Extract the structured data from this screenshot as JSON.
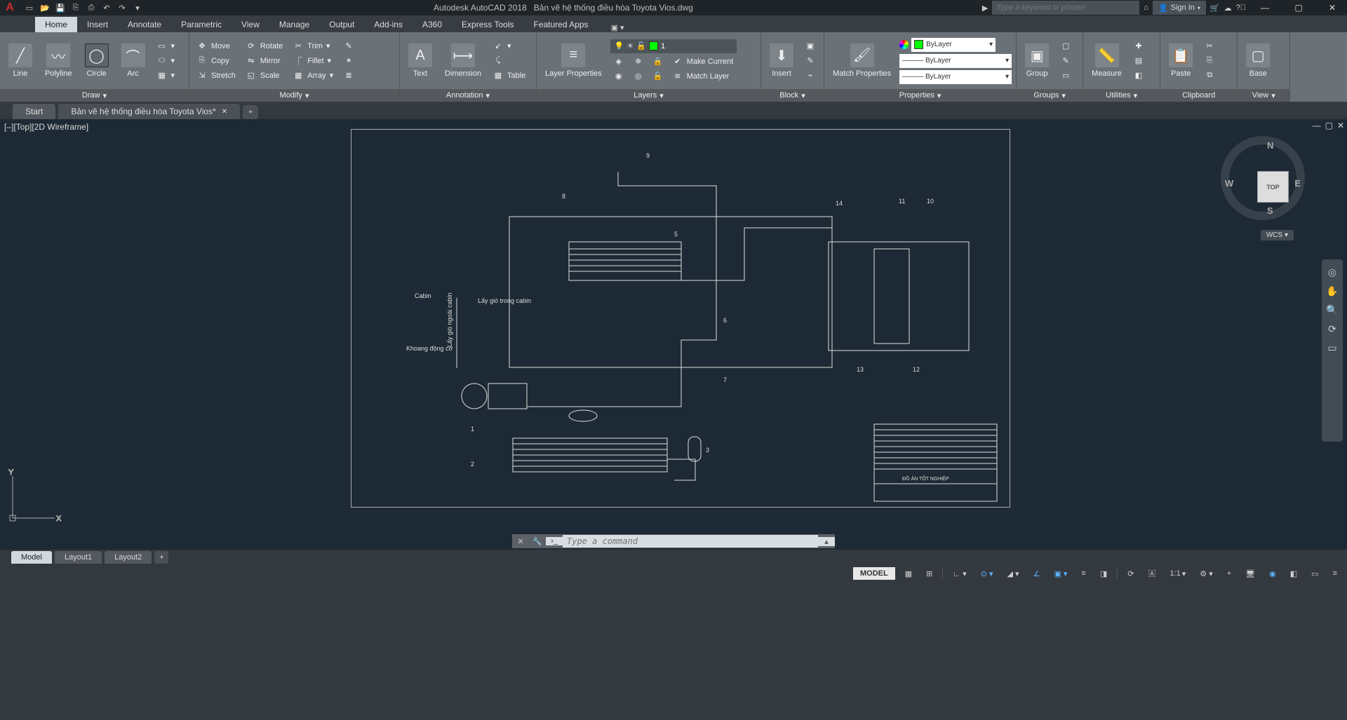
{
  "qat_icons": [
    "new",
    "open",
    "save",
    "saveas",
    "print",
    "undo",
    "redo"
  ],
  "title": {
    "app": "Autodesk AutoCAD 2018",
    "doc": "Bản vẽ hệ thống điều hòa Toyota Vios.dwg"
  },
  "search_placeholder": "Type a keyword or phrase",
  "signin": "Sign In",
  "tabs": [
    "Home",
    "Insert",
    "Annotate",
    "Parametric",
    "View",
    "Manage",
    "Output",
    "Add-ins",
    "A360",
    "Express Tools",
    "Featured Apps"
  ],
  "active_tab": "Home",
  "panels": {
    "draw": {
      "label": "Draw",
      "items": [
        "Line",
        "Polyline",
        "Circle",
        "Arc"
      ]
    },
    "modify": {
      "label": "Modify",
      "rows": [
        [
          "Move",
          "Rotate",
          "Trim"
        ],
        [
          "Copy",
          "Mirror",
          "Fillet"
        ],
        [
          "Stretch",
          "Scale",
          "Array"
        ]
      ]
    },
    "annotation": {
      "label": "Annotation",
      "items": [
        "Text",
        "Dimension",
        "Table"
      ]
    },
    "layers": {
      "label": "Layers",
      "main": "Layer Properties",
      "current": "1",
      "side": [
        "Make Current",
        "Match Layer"
      ]
    },
    "block": {
      "label": "Block",
      "items": [
        "Insert"
      ]
    },
    "properties": {
      "label": "Properties",
      "main": "Match Properties",
      "bylayer": "ByLayer"
    },
    "groups": {
      "label": "Groups",
      "items": [
        "Group"
      ]
    },
    "utilities": {
      "label": "Utilities",
      "items": [
        "Measure"
      ]
    },
    "clipboard": {
      "label": "Clipboard",
      "items": [
        "Paste"
      ]
    },
    "view": {
      "label": "View",
      "items": [
        "Base"
      ]
    }
  },
  "file_tabs": [
    {
      "label": "Start"
    },
    {
      "label": "Bản vẽ hệ thống điều hòa Toyota Vios*",
      "close": true
    }
  ],
  "viewport_label": "[–][Top][2D Wireframe]",
  "navcube": {
    "top": "TOP",
    "n": "N",
    "s": "S",
    "e": "E",
    "w": "W"
  },
  "wcs": "WCS",
  "ucs": {
    "x": "X",
    "y": "Y"
  },
  "drawing_labels": {
    "cabin": "Cabin",
    "laygio": "Lấy gió trong cabin",
    "laygioout": "Lấy gió ngoài cabin",
    "khoang": "Khoang động cơ",
    "titleblock": "ĐỒ ÁN TỐT NGHIỆP",
    "nums": {
      "1": "1",
      "2": "2",
      "3": "3",
      "5": "5",
      "6": "6",
      "7": "7",
      "8": "8",
      "9": "9",
      "10": "10",
      "11": "11",
      "12": "12",
      "13": "13",
      "14": "14"
    }
  },
  "cmd_placeholder": "Type a command",
  "model_tabs": [
    "Model",
    "Layout1",
    "Layout2"
  ],
  "status": {
    "model": "MODEL",
    "scale": "1:1"
  }
}
